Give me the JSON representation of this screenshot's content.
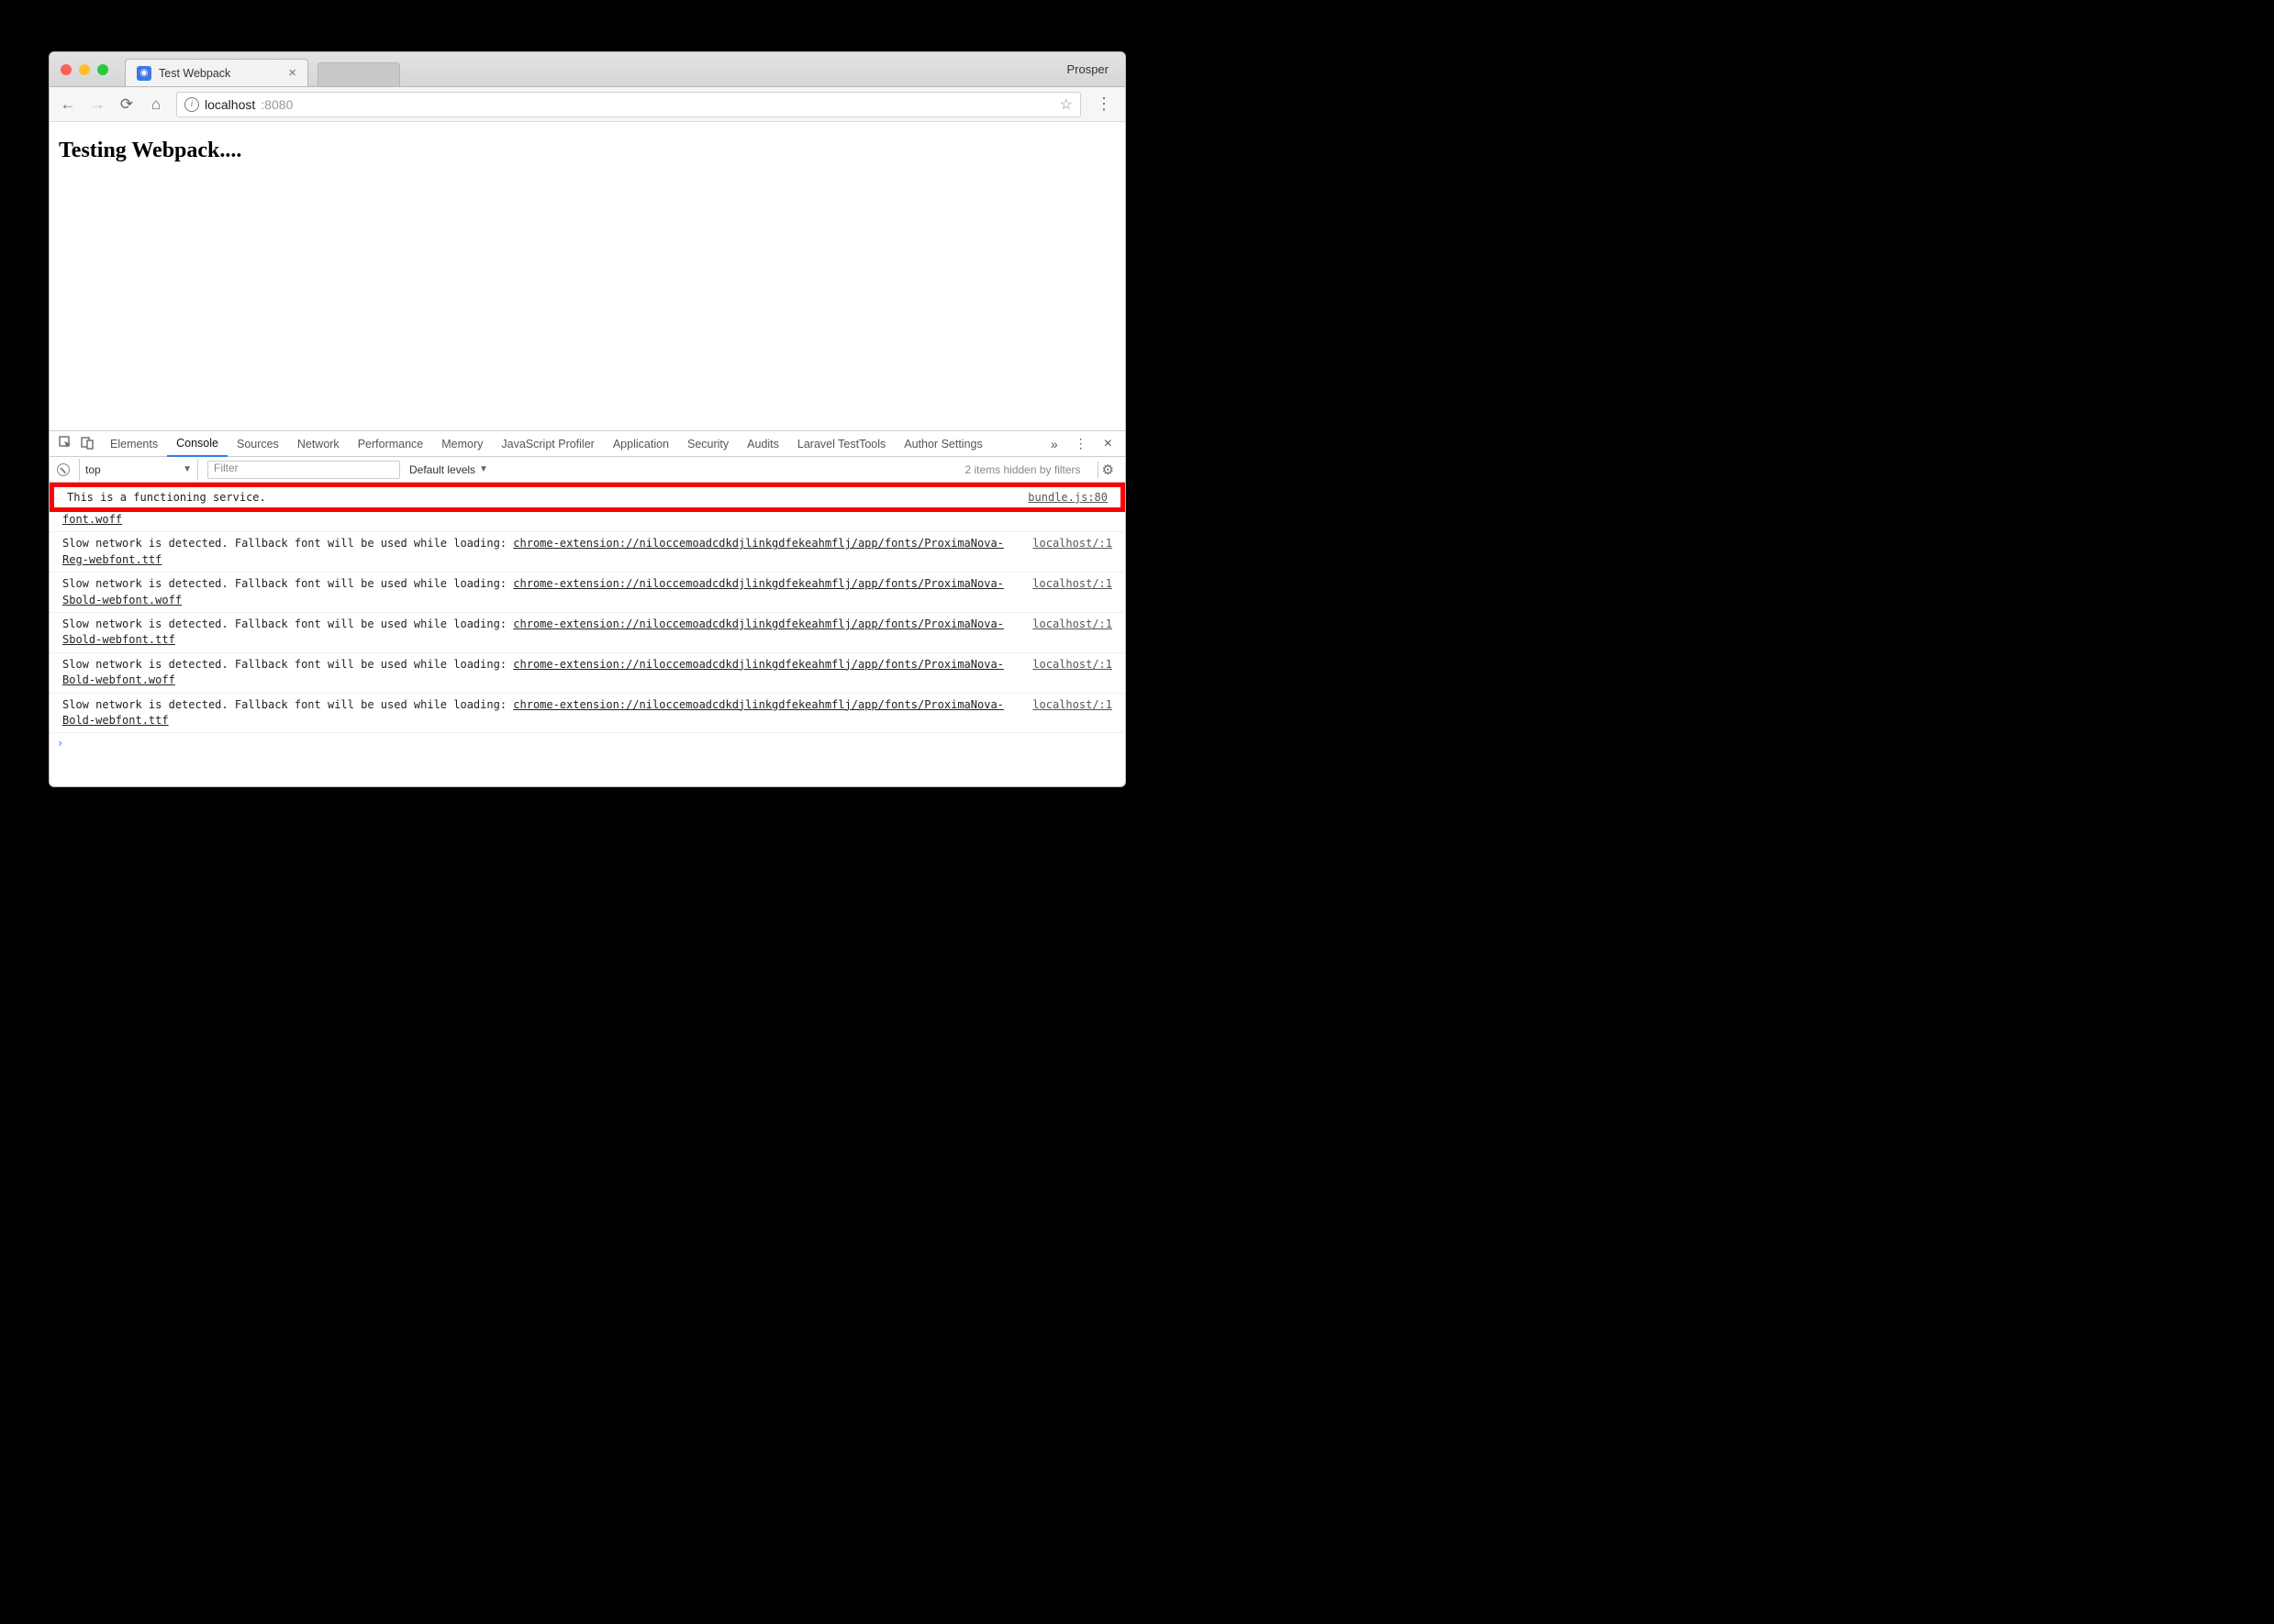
{
  "browser": {
    "tab_title": "Test Webpack",
    "profile_name": "Prosper",
    "url_host": "localhost",
    "url_port": ":8080"
  },
  "page": {
    "heading": "Testing Webpack...."
  },
  "devtools": {
    "tabs": [
      "Elements",
      "Console",
      "Sources",
      "Network",
      "Performance",
      "Memory",
      "JavaScript Profiler",
      "Application",
      "Security",
      "Audits",
      "Laravel TestTools",
      "Author Settings"
    ],
    "active_tab_index": 1,
    "context": "top",
    "filter_placeholder": "Filter",
    "levels_label": "Default levels",
    "hidden_text": "2 items hidden by filters"
  },
  "console": {
    "highlighted": {
      "text": "This is a functioning service.",
      "source": "bundle.js:80"
    },
    "truncated_link_tail": "font.woff",
    "messages": [
      {
        "prefix": "Slow network is detected. Fallback font will be used while loading: ",
        "link": "chrome-extension://niloccemoadcdkdjlinkgdfekeahmflj/app/fonts/ProximaNova-Reg-webfont.ttf",
        "location": "localhost/:1"
      },
      {
        "prefix": "Slow network is detected. Fallback font will be used while loading: ",
        "link": "chrome-extension://niloccemoadcdkdjlinkgdfekeahmflj/app/fonts/ProximaNova-Sbold-webfont.woff",
        "location": "localhost/:1"
      },
      {
        "prefix": "Slow network is detected. Fallback font will be used while loading: ",
        "link": "chrome-extension://niloccemoadcdkdjlinkgdfekeahmflj/app/fonts/ProximaNova-Sbold-webfont.ttf",
        "location": "localhost/:1"
      },
      {
        "prefix": "Slow network is detected. Fallback font will be used while loading: ",
        "link": "chrome-extension://niloccemoadcdkdjlinkgdfekeahmflj/app/fonts/ProximaNova-Bold-webfont.woff",
        "location": "localhost/:1"
      },
      {
        "prefix": "Slow network is detected. Fallback font will be used while loading: ",
        "link": "chrome-extension://niloccemoadcdkdjlinkgdfekeahmflj/app/fonts/ProximaNova-Bold-webfont.ttf",
        "location": "localhost/:1"
      }
    ]
  }
}
